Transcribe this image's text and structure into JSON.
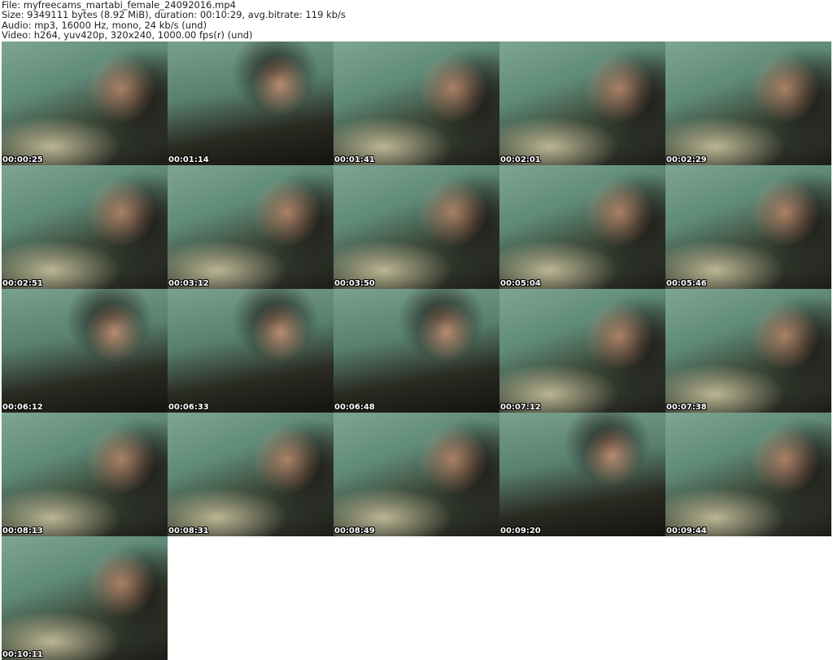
{
  "header": {
    "file": "File: myfreecams_martabi_female_24092016.mp4",
    "size": "Size: 9349111 bytes (8.92 MiB), duration: 00:10:29, avg.bitrate: 119 kb/s",
    "audio": "Audio: mp3, 16000 Hz, mono, 24 kb/s (und)",
    "video": "Video: h264, yuv420p, 320x240, 1000.00 fps(r) (und)"
  },
  "thumbnails": [
    {
      "time": "00:00:25"
    },
    {
      "time": "00:01:14"
    },
    {
      "time": "00:01:41"
    },
    {
      "time": "00:02:01"
    },
    {
      "time": "00:02:29"
    },
    {
      "time": "00:02:51"
    },
    {
      "time": "00:03:12"
    },
    {
      "time": "00:03:50"
    },
    {
      "time": "00:05:04"
    },
    {
      "time": "00:05:46"
    },
    {
      "time": "00:06:12"
    },
    {
      "time": "00:06:33"
    },
    {
      "time": "00:06:48"
    },
    {
      "time": "00:07:12"
    },
    {
      "time": "00:07:38"
    },
    {
      "time": "00:08:13"
    },
    {
      "time": "00:08:31"
    },
    {
      "time": "00:08:49"
    },
    {
      "time": "00:09:20"
    },
    {
      "time": "00:09:44"
    },
    {
      "time": "00:10:11"
    }
  ]
}
